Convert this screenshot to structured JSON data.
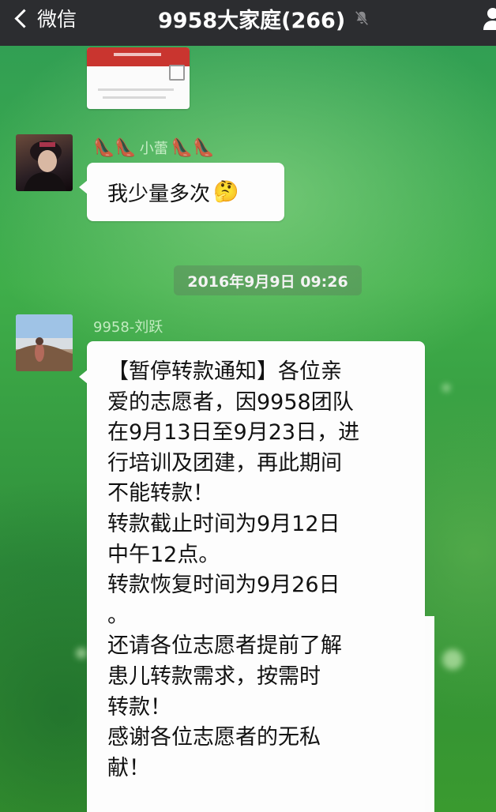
{
  "header": {
    "back_label": "微信",
    "title": "9958大家庭(266)",
    "icons": [
      "chevron-left-icon",
      "mute-bell-icon",
      "profile-icon"
    ]
  },
  "messages": [
    {
      "type": "image",
      "sender": "self-or-earlier",
      "note": ""
    },
    {
      "type": "text",
      "sender_name": "小蕾",
      "sender_decoration": "👠👠",
      "text": "我少量多次",
      "emoji": "🤔"
    },
    {
      "type": "timestamp",
      "text": "2016年9月9日 09:26"
    },
    {
      "type": "text",
      "sender_name": "9958-刘跃",
      "text": "【暂停转款通知】各位亲\n爱的志愿者，因9958团队\n在9月13日至9月23日，进\n行培训及团建，再此期间\n不能转款！\n转款截止时间为9月12日\n中午12点。\n转款恢复时间为9月26日\n。\n还请各位志愿者提前了解\n患儿转款需求，按需时\n转款！\n感谢各位志愿者的无私\n献！"
    }
  ],
  "colors": {
    "titlebar": "#2c2d30",
    "bubble": "#fdfdfd",
    "background": "#3fae4a"
  }
}
